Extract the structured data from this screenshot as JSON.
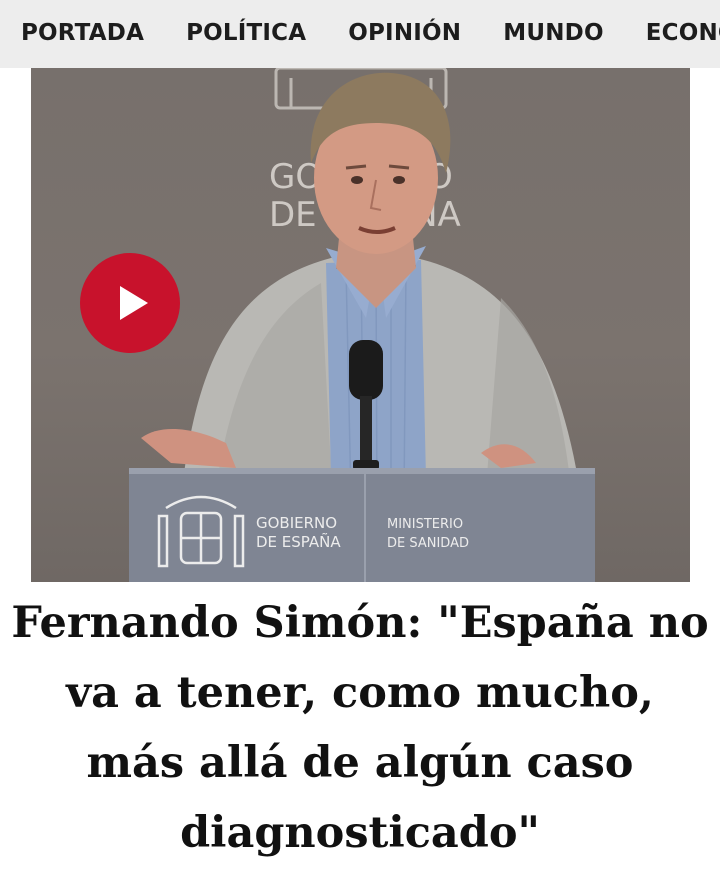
{
  "nav": {
    "items": [
      {
        "label": "PORTADA"
      },
      {
        "label": "POLÍTICA"
      },
      {
        "label": "OPINIÓN"
      },
      {
        "label": "MUNDO"
      },
      {
        "label": "ECONOMÍA"
      }
    ]
  },
  "video": {
    "background_sign": {
      "line1": "GOBIERNO",
      "line2": "DE ESPAÑA"
    },
    "lectern": {
      "left_line1": "GOBIERNO",
      "left_line2": "DE ESPAÑA",
      "right_line1": "MINISTERIO",
      "right_line2": "DE SANIDAD"
    },
    "play_icon": "play-icon",
    "colors": {
      "play": "#c8122c"
    }
  },
  "article": {
    "headline": "Fernando Simón: \"España no va a tener, como mucho, más allá de algún caso diagnosticado\""
  }
}
